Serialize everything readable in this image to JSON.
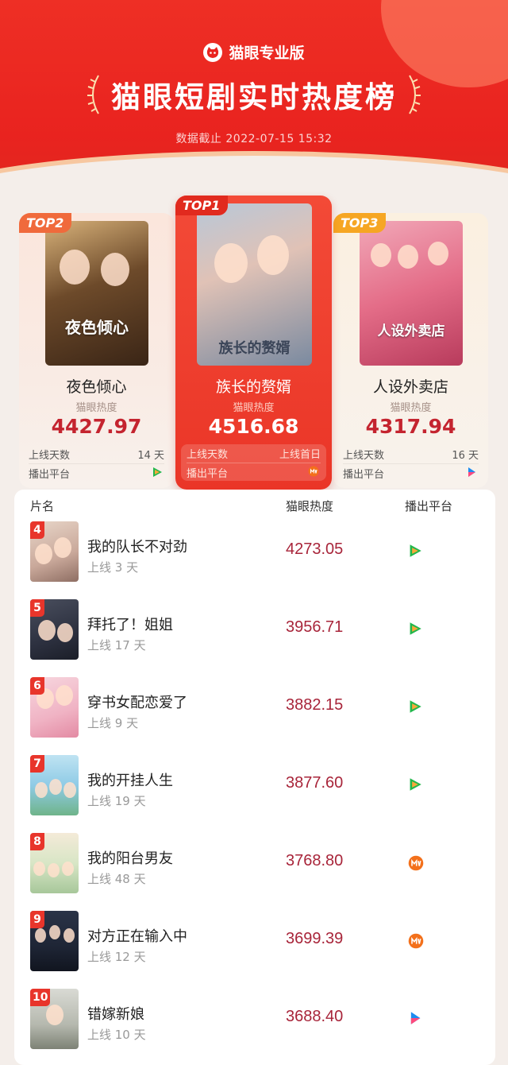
{
  "header": {
    "brand": "猫眼专业版",
    "title": "猫眼短剧实时热度榜",
    "timestamp": "数据截止 2022-07-15 15:32"
  },
  "podium": {
    "heat_label": "猫眼热度",
    "days_label": "上线天数",
    "platform_label": "播出平台",
    "first": {
      "rank": "TOP1",
      "name": "族长的赘婿",
      "heat": "4516.68",
      "days": "上线首日",
      "platform_icon": "mango-tv-icon",
      "poster_text": "族长的赘婿"
    },
    "second": {
      "rank": "TOP2",
      "name": "夜色倾心",
      "heat": "4427.97",
      "days": "14 天",
      "platform_icon": "tencent-video-icon",
      "poster_text": "夜色倾心"
    },
    "third": {
      "rank": "TOP3",
      "name": "人设外卖店",
      "heat": "4317.94",
      "days": "16 天",
      "platform_icon": "youku-icon",
      "poster_text": "人设外卖店"
    }
  },
  "list": {
    "headers": {
      "name": "片名",
      "heat": "猫眼热度",
      "platform": "播出平台"
    },
    "rows": [
      {
        "rank": "4",
        "name": "我的队长不对劲",
        "days": "上线 3 天",
        "heat": "4273.05",
        "platform_icon": "tencent-video-icon"
      },
      {
        "rank": "5",
        "name": "拜托了！姐姐",
        "days": "上线 17 天",
        "heat": "3956.71",
        "platform_icon": "tencent-video-icon"
      },
      {
        "rank": "6",
        "name": "穿书女配恋爱了",
        "days": "上线 9 天",
        "heat": "3882.15",
        "platform_icon": "tencent-video-icon"
      },
      {
        "rank": "7",
        "name": "我的开挂人生",
        "days": "上线 19 天",
        "heat": "3877.60",
        "platform_icon": "tencent-video-icon"
      },
      {
        "rank": "8",
        "name": "我的阳台男友",
        "days": "上线 48 天",
        "heat": "3768.80",
        "platform_icon": "mango-tv-icon"
      },
      {
        "rank": "9",
        "name": "对方正在输入中",
        "days": "上线 12 天",
        "heat": "3699.39",
        "platform_icon": "mango-tv-icon"
      },
      {
        "rank": "10",
        "name": "错嫁新娘",
        "days": "上线 10 天",
        "heat": "3688.40",
        "platform_icon": "youku-icon"
      }
    ]
  },
  "colors": {
    "header_red": "#e9231f",
    "heat_red": "#c4242f",
    "rank_red": "#e8352b",
    "tencent_green": "#22b74c",
    "mango_orange": "#f3701b",
    "youku_blue": "#1e8cf0",
    "youku_pink": "#ff4a7d"
  }
}
